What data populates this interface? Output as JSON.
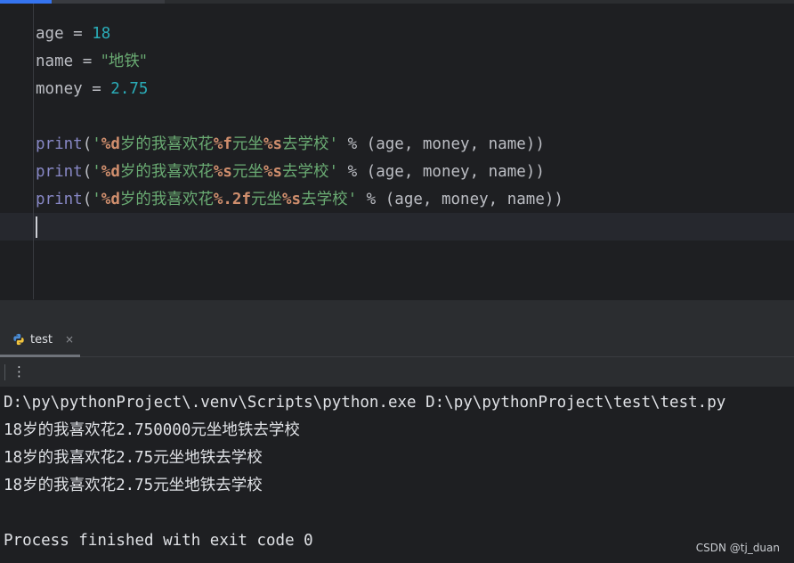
{
  "editor": {
    "lines": {
      "l1": {
        "var": "age",
        "op": " = ",
        "val": "18"
      },
      "l2": {
        "var": "name",
        "op": " = ",
        "val": "\"地铁\""
      },
      "l3": {
        "var": "money",
        "op": " = ",
        "val": "2.75"
      },
      "l5": {
        "fn": "print",
        "open": "(",
        "q1": "'",
        "f1": "%d",
        "t1": "岁的我喜欢花",
        "f2": "%f",
        "t2": "元坐",
        "f3": "%s",
        "t3": "去学校",
        "q2": "'",
        "rest": " % (age, money, name))"
      },
      "l6": {
        "fn": "print",
        "open": "(",
        "q1": "'",
        "f1": "%d",
        "t1": "岁的我喜欢花",
        "f2": "%s",
        "t2": "元坐",
        "f3": "%s",
        "t3": "去学校",
        "q2": "'",
        "rest": " % (age, money, name))"
      },
      "l7": {
        "fn": "print",
        "open": "(",
        "q1": "'",
        "f1": "%d",
        "t1": "岁的我喜欢花",
        "f2": "%.2f",
        "t2": "元坐",
        "f3": "%s",
        "t3": "去学校",
        "q2": "'",
        "rest": " % (age, money, name))"
      }
    }
  },
  "run_panel": {
    "tab_label": "test",
    "tab_close": "×",
    "more_icon": "more-vertical-icon",
    "output": [
      "D:\\py\\pythonProject\\.venv\\Scripts\\python.exe D:\\py\\pythonProject\\test\\test.py",
      "18岁的我喜欢花2.750000元坐地铁去学校",
      "18岁的我喜欢花2.75元坐地铁去学校",
      "18岁的我喜欢花2.75元坐地铁去学校",
      "",
      "Process finished with exit code 0"
    ]
  },
  "watermark": "CSDN @tj_duan",
  "colors": {
    "background": "#1e1f22",
    "panel": "#2b2d30",
    "number": "#2aacb8",
    "string": "#6aab73",
    "builtin": "#8888c6",
    "format_spec": "#cf8e6d",
    "accent": "#3574f0"
  }
}
